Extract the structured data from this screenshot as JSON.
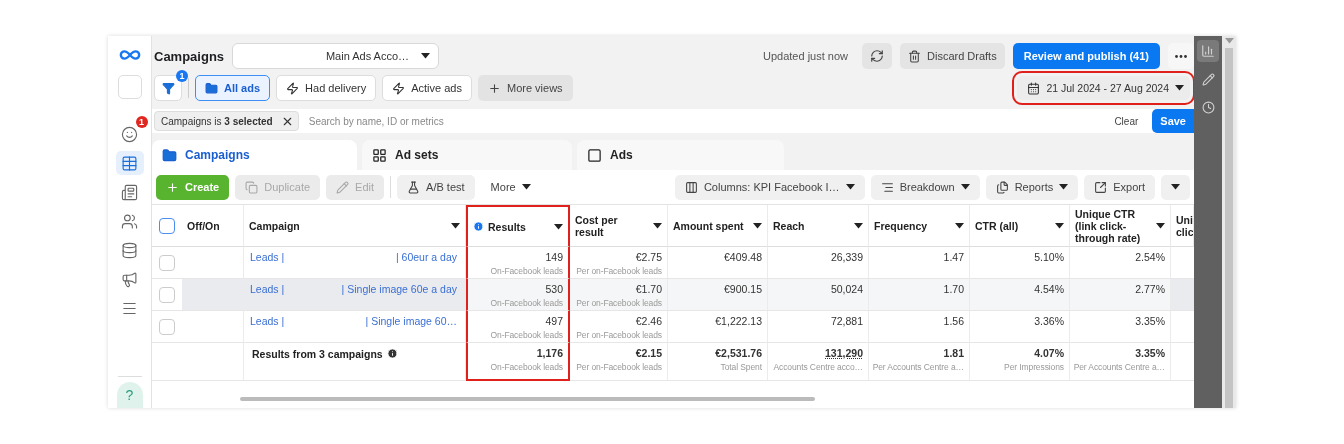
{
  "nav": {
    "items": [
      {
        "kind": "blank",
        "selected": false
      },
      {
        "kind": "face",
        "selected": false,
        "badge": "1"
      },
      {
        "kind": "table",
        "selected": true
      },
      {
        "kind": "pages",
        "selected": false
      },
      {
        "kind": "people",
        "selected": false
      },
      {
        "kind": "coins",
        "selected": false
      },
      {
        "kind": "megaphone",
        "selected": false
      },
      {
        "kind": "menu",
        "selected": false
      }
    ],
    "help": "?"
  },
  "header": {
    "title": "Campaigns",
    "account": "Main Ads Acco…",
    "updated": "Updated just now",
    "discard": "Discard Drafts",
    "publish": "Review and publish (41)"
  },
  "views": {
    "filter_badge": "1",
    "items": [
      {
        "label": "All ads",
        "kind": "folder",
        "selected": true
      },
      {
        "label": "Had delivery",
        "kind": "bolt",
        "selected": false
      },
      {
        "label": "Active ads",
        "kind": "bolt",
        "selected": false
      }
    ],
    "more": "More views",
    "date_range": "21 Jul 2024 - 27 Aug 2024",
    "date_highlighted": true
  },
  "filter": {
    "chip": "Campaigns is **3 selected**",
    "placeholder": "Search by name, ID or metrics",
    "clear": "Clear",
    "save": "Save"
  },
  "level_tabs": [
    {
      "label": "Campaigns",
      "kind": "campaigns",
      "selected": true
    },
    {
      "label": "Ad sets",
      "kind": "adsets",
      "selected": false
    },
    {
      "label": "Ads",
      "kind": "ads",
      "selected": false
    }
  ],
  "toolbar": {
    "left": [
      {
        "label": "Create",
        "kind": "create",
        "disabled": false
      },
      {
        "label": "Duplicate",
        "kind": "duplicate",
        "disabled": true
      },
      {
        "label": "Edit",
        "kind": "edit",
        "disabled": true
      },
      {
        "label": "A/B test",
        "kind": "abtest",
        "disabled": false
      },
      {
        "label": "More",
        "kind": "more",
        "disabled": false
      }
    ],
    "right": [
      {
        "label": "Columns: KPI Facebook I…",
        "kind": "columns"
      },
      {
        "label": "Breakdown",
        "kind": "breakdown"
      },
      {
        "label": "Reports",
        "kind": "reports"
      },
      {
        "label": "Export",
        "kind": "export"
      },
      {
        "kind": "caret"
      }
    ]
  },
  "table": {
    "all_checked": false,
    "columns": [
      {
        "label": "Off/On",
        "sortable": false,
        "info": false,
        "highlighted": false
      },
      {
        "label": "Campaign",
        "sortable": true,
        "info": false,
        "highlighted": false
      },
      {
        "label": "Results",
        "sortable": true,
        "info": true,
        "highlighted": true
      },
      {
        "label": "Cost per result",
        "sortable": true,
        "info": false,
        "highlighted": false
      },
      {
        "label": "Amount spent",
        "sortable": true,
        "info": false,
        "highlighted": false
      },
      {
        "label": "Reach",
        "sortable": true,
        "info": false,
        "highlighted": false
      },
      {
        "label": "Frequency",
        "sortable": true,
        "info": false,
        "highlighted": false
      },
      {
        "label": "CTR (all)",
        "sortable": true,
        "info": false,
        "highlighted": false
      },
      {
        "label": "Unique CTR (link click-through rate)",
        "sortable": true,
        "info": false,
        "highlighted": false
      },
      {
        "label": "Uni clic",
        "sortable": false,
        "info": false,
        "highlighted": false
      }
    ],
    "rows": [
      {
        "checked": false,
        "hovered": false,
        "cells": [
          "",
          {
            "name_start": "Leads |",
            "name_end": "| 60eur a day"
          },
          {
            "value": "149",
            "sub": "On-Facebook leads"
          },
          {
            "value": "€2.75",
            "sub": "Per on-Facebook leads"
          },
          {
            "value": "€409.48"
          },
          {
            "value": "26,339"
          },
          {
            "value": "1.47"
          },
          {
            "value": "5.10%"
          },
          {
            "value": "2.54%"
          }
        ]
      },
      {
        "checked": false,
        "hovered": true,
        "cells": [
          "",
          {
            "name_start": "Leads |",
            "name_end": "| Single image 60e a day"
          },
          {
            "value": "530",
            "sub": "On-Facebook leads"
          },
          {
            "value": "€1.70",
            "sub": "Per on-Facebook leads"
          },
          {
            "value": "€900.15"
          },
          {
            "value": "50,024"
          },
          {
            "value": "1.70"
          },
          {
            "value": "4.54%"
          },
          {
            "value": "2.77%"
          }
        ]
      },
      {
        "checked": false,
        "hovered": false,
        "cells": [
          "",
          {
            "name_start": "Leads |",
            "name_end": "| Single image 60…"
          },
          {
            "value": "497",
            "sub": "On-Facebook leads"
          },
          {
            "value": "€2.46",
            "sub": "Per on-Facebook leads"
          },
          {
            "value": "€1,222.13"
          },
          {
            "value": "72,881"
          },
          {
            "value": "1.56"
          },
          {
            "value": "3.36%"
          },
          {
            "value": "3.35%"
          }
        ]
      }
    ],
    "totals": {
      "cells": [
        "",
        {
          "label": "Results from 3 campaigns"
        },
        {
          "value": "1,176",
          "sub": "On-Facebook leads"
        },
        {
          "value": "€2.15",
          "sub": "Per on-Facebook leads"
        },
        {
          "value": "€2,531.76",
          "sub": "Total Spent"
        },
        {
          "value": "131,290",
          "sub": "Accounts Centre acco…",
          "dotted": true
        },
        {
          "value": "1.81",
          "sub": "Per Accounts Centre a…"
        },
        {
          "value": "4.07%",
          "sub": "Per Impressions"
        },
        {
          "value": "3.35%",
          "sub": "Per Accounts Centre a…"
        }
      ]
    }
  }
}
